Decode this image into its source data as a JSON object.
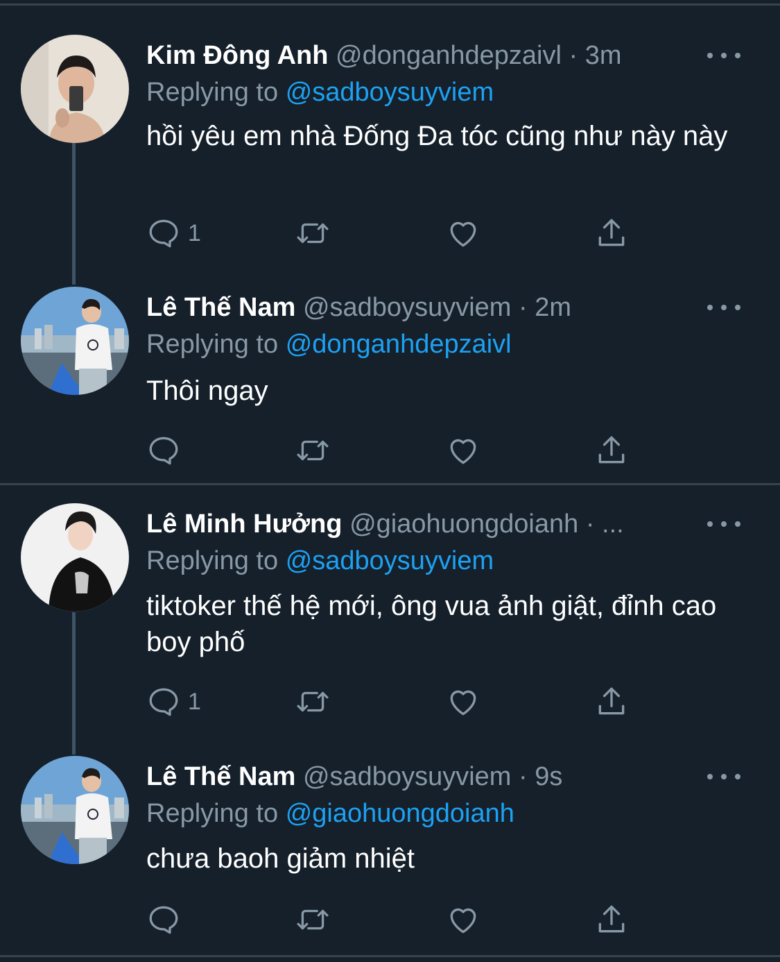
{
  "colors": {
    "background": "#15202b",
    "divider": "#38444d",
    "secondary_text": "#8899a6",
    "mention": "#1da1f2",
    "thread_line": "#3d5466"
  },
  "tweets": [
    {
      "name": "Kim Đông Anh",
      "handle": "@donganhdepzaivl",
      "separator": "·",
      "time": "3m",
      "replying_prefix": "Replying to",
      "replying_to": "@sadboysuyviem",
      "text": "hồi yêu em nhà Đống Đa tóc cũng như này này",
      "reply_count": "1",
      "avatar_icon": "avatar-photo-mirror-selfie"
    },
    {
      "name": "Lê Thế Nam",
      "handle": "@sadboysuyviem",
      "separator": "·",
      "time": "2m",
      "replying_prefix": "Replying to",
      "replying_to": "@donganhdepzaivl",
      "text": "Thôi ngay",
      "reply_count": "",
      "avatar_icon": "avatar-photo-boat-city"
    },
    {
      "name": "Lê Minh Hưởng",
      "handle": "@giaohuongdoianh",
      "separator": "·",
      "time": "",
      "ellipsis": "...",
      "replying_prefix": "Replying to",
      "replying_to": "@sadboysuyviem",
      "text": "tiktoker thế hệ mới, ông vua ảnh giật, đỉnh cao boy phố",
      "reply_count": "1",
      "avatar_icon": "avatar-photo-black-hoodie"
    },
    {
      "name": "Lê Thế Nam",
      "handle": "@sadboysuyviem",
      "separator": "·",
      "time": "9s",
      "replying_prefix": "Replying to",
      "replying_to": "@giaohuongdoianh",
      "text": "chưa baoh giảm nhiệt",
      "reply_count": "",
      "avatar_icon": "avatar-photo-boat-city"
    }
  ],
  "icons": {
    "reply": "speech-bubble-icon",
    "retweet": "retweet-arrows-icon",
    "like": "heart-outline-icon",
    "share": "share-upload-icon",
    "more": "three-dots-icon"
  }
}
